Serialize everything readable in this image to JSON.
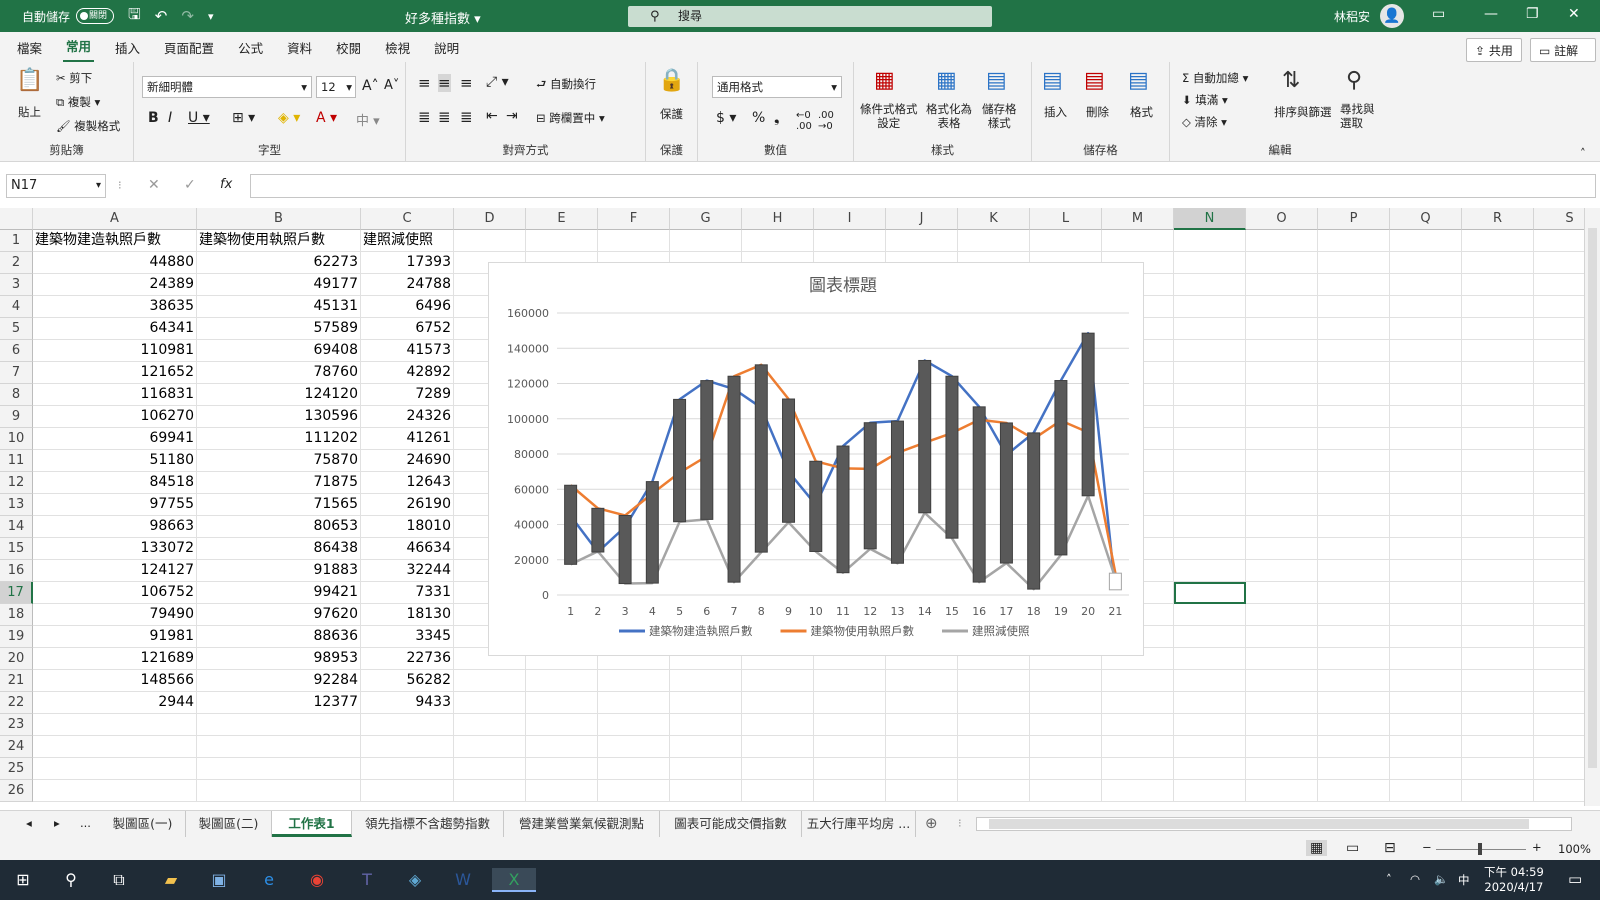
{
  "titlebar": {
    "autosave_label": "自動儲存",
    "autosave_state": "關閉",
    "doc_title": "好多種指數",
    "search_placeholder": "搜尋",
    "user_name": "林稆安"
  },
  "menu": [
    "檔案",
    "常用",
    "插入",
    "頁面配置",
    "公式",
    "資料",
    "校閱",
    "檢視",
    "說明"
  ],
  "menu_active": "常用",
  "share_label": "共用",
  "comment_label": "註解",
  "ribbon": {
    "clipboard": {
      "paste": "貼上",
      "cut": "剪下",
      "copy": "複製",
      "format_painter": "複製格式",
      "label": "剪貼簿"
    },
    "font": {
      "name": "新細明體",
      "size": "12",
      "label": "字型"
    },
    "align": {
      "wrap": "自動換行",
      "merge": "跨欄置中",
      "label": "對齊方式"
    },
    "protect": {
      "btn": "保護",
      "label": "保護"
    },
    "number": {
      "format": "通用格式",
      "label": "數值"
    },
    "styles": {
      "cond": "條件式格式\n設定",
      "table": "格式化為\n表格",
      "cell": "儲存格\n樣式",
      "label": "樣式"
    },
    "cells": {
      "insert": "插入",
      "delete": "刪除",
      "format": "格式",
      "label": "儲存格"
    },
    "editing": {
      "autosum": "自動加總",
      "fill": "填滿",
      "clear": "清除",
      "sort": "排序與篩選",
      "find": "尋找與\n選取",
      "label": "編輯"
    }
  },
  "namebox": "N17",
  "columns": [
    "A",
    "B",
    "C",
    "D",
    "E",
    "F",
    "G",
    "H",
    "I",
    "J",
    "K",
    "L",
    "M",
    "N",
    "O",
    "P",
    "Q",
    "R",
    "S"
  ],
  "selected_col": "N",
  "selected_row": 17,
  "headers": [
    "建築物建造執照戶數",
    "建築物使用執照戶數",
    "建照減使照"
  ],
  "rows": [
    [
      44880,
      62273,
      17393
    ],
    [
      24389,
      49177,
      24788
    ],
    [
      38635,
      45131,
      6496
    ],
    [
      64341,
      57589,
      6752
    ],
    [
      110981,
      69408,
      41573
    ],
    [
      121652,
      78760,
      42892
    ],
    [
      116831,
      124120,
      7289
    ],
    [
      106270,
      130596,
      24326
    ],
    [
      69941,
      111202,
      41261
    ],
    [
      51180,
      75870,
      24690
    ],
    [
      84518,
      71875,
      12643
    ],
    [
      97755,
      71565,
      26190
    ],
    [
      98663,
      80653,
      18010
    ],
    [
      133072,
      86438,
      46634
    ],
    [
      124127,
      91883,
      32244
    ],
    [
      106752,
      99421,
      7331
    ],
    [
      79490,
      97620,
      18130
    ],
    [
      91981,
      88636,
      3345
    ],
    [
      121689,
      98953,
      22736
    ],
    [
      148566,
      92284,
      56282
    ],
    [
      2944,
      12377,
      9433
    ]
  ],
  "row_numbers": [
    1,
    2,
    3,
    4,
    5,
    6,
    7,
    8,
    9,
    10,
    11,
    12,
    13,
    14,
    15,
    16,
    17,
    18,
    19,
    20,
    21,
    22,
    23,
    24,
    25,
    26
  ],
  "chart_data": {
    "type": "line",
    "title": "圖表標題",
    "x": [
      1,
      2,
      3,
      4,
      5,
      6,
      7,
      8,
      9,
      10,
      11,
      12,
      13,
      14,
      15,
      16,
      17,
      18,
      19,
      20,
      21
    ],
    "ylim": [
      0,
      160000
    ],
    "yticks": [
      0,
      20000,
      40000,
      60000,
      80000,
      100000,
      120000,
      140000,
      160000
    ],
    "grid": true,
    "legend": "bottom",
    "high_low_bars": true,
    "series": [
      {
        "name": "建築物建造執照戶數",
        "color": "#4472c4",
        "values": [
          44880,
          24389,
          38635,
          64341,
          110981,
          121652,
          116831,
          106270,
          69941,
          51180,
          84518,
          97755,
          98663,
          133072,
          124127,
          106752,
          79490,
          91981,
          121689,
          148566,
          2944
        ]
      },
      {
        "name": "建築物使用執照戶數",
        "color": "#ed7d31",
        "values": [
          62273,
          49177,
          45131,
          57589,
          69408,
          78760,
          124120,
          130596,
          111202,
          75870,
          71875,
          71565,
          80653,
          86438,
          91883,
          99421,
          97620,
          88636,
          98953,
          92284,
          12377
        ]
      },
      {
        "name": "建照減使照",
        "color": "#a5a5a5",
        "values": [
          17393,
          24788,
          6496,
          6752,
          41573,
          42892,
          7289,
          24326,
          41261,
          24690,
          12643,
          26190,
          18010,
          46634,
          32244,
          7331,
          18130,
          3345,
          22736,
          56282,
          9433
        ]
      }
    ]
  },
  "sheets": [
    "製圖區(一)",
    "製圖區(二)",
    "工作表1",
    "領先指標不含趨勢指數",
    "營建業營業氣候觀測點",
    "圖表可能成交價指數",
    "五大行庫平均房 ..."
  ],
  "active_sheet": "工作表1",
  "zoom": "100%",
  "clock": {
    "time": "下午 04:59",
    "date": "2020/4/17"
  },
  "ime": "中"
}
